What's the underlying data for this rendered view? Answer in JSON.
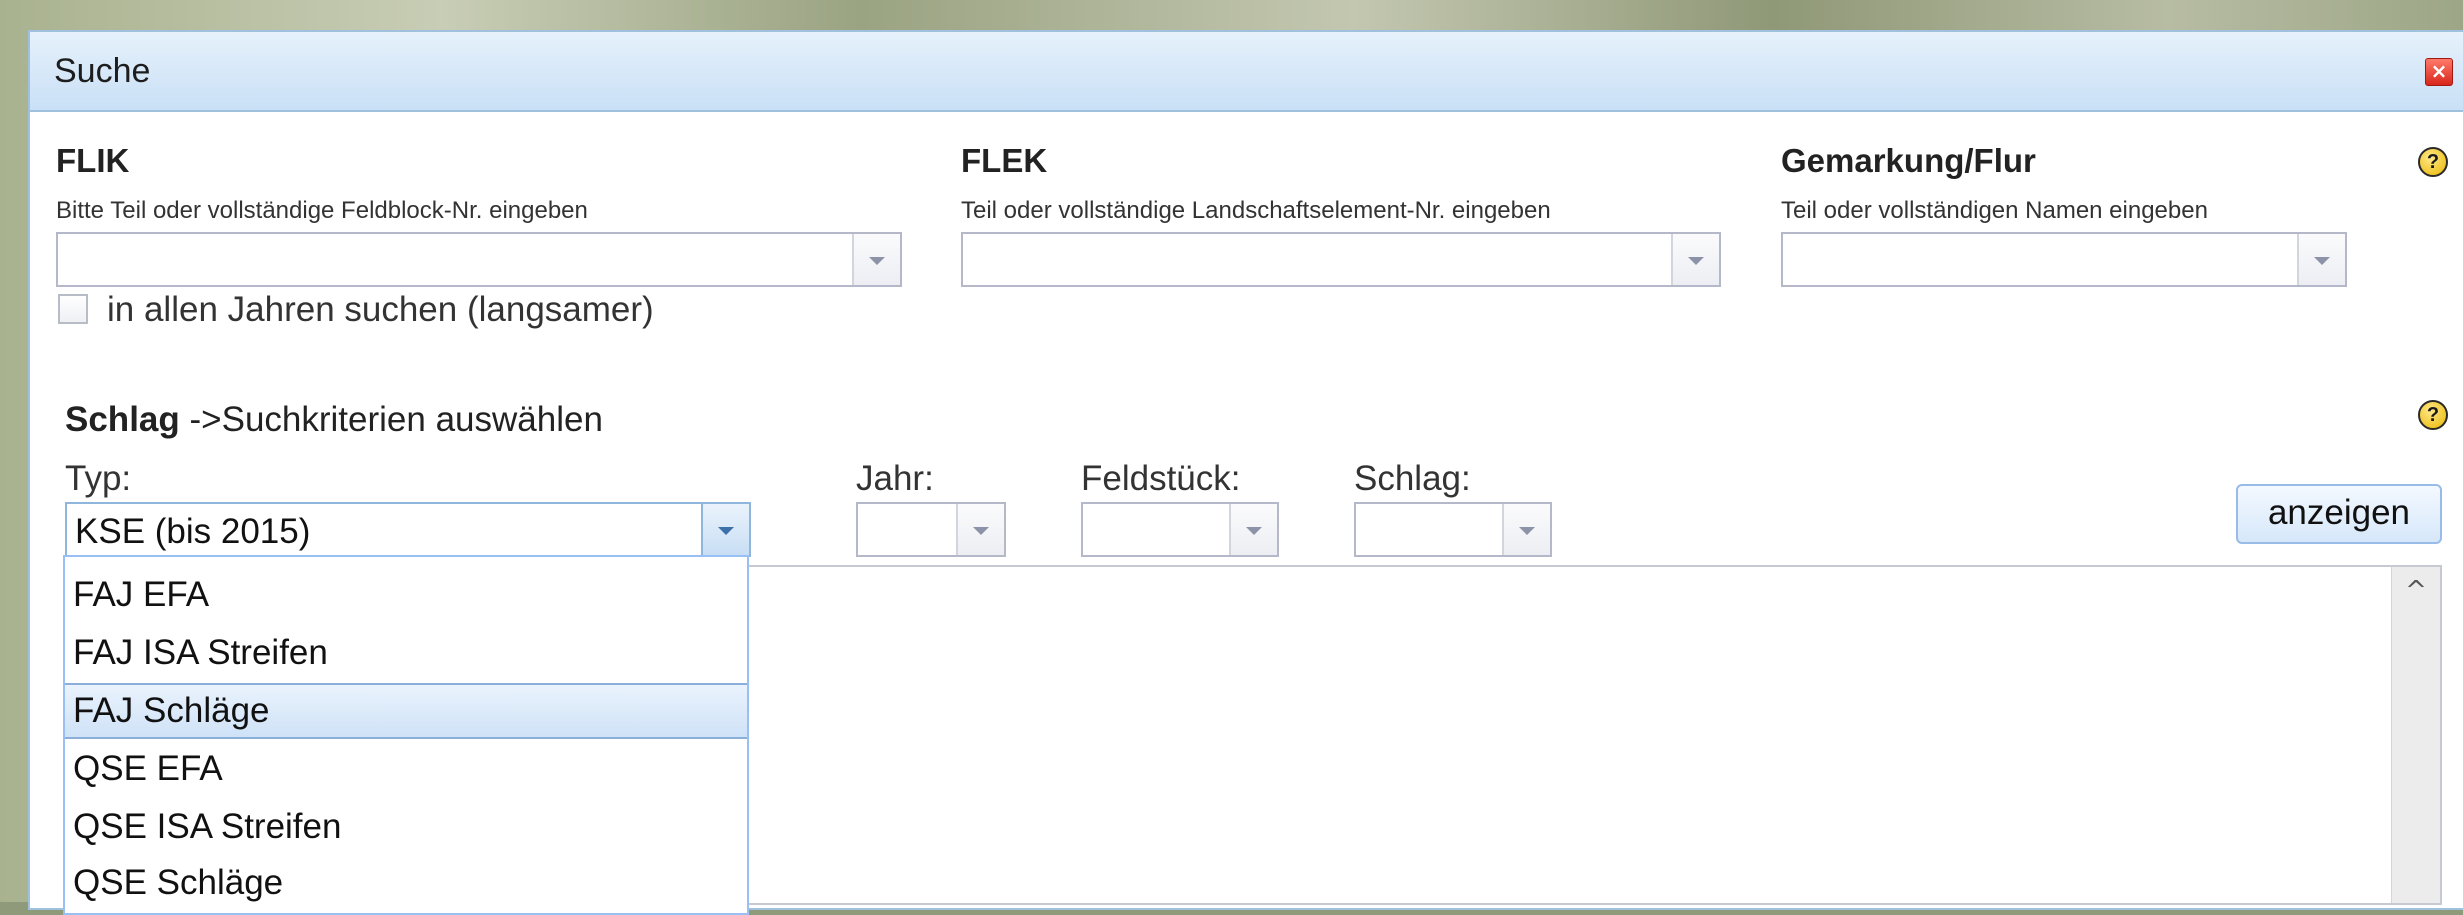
{
  "window": {
    "title": "Suche"
  },
  "flik": {
    "title": "FLIK",
    "hint": "Bitte Teil oder vollständige Feldblock-Nr. eingeben",
    "value": "",
    "all_years_label": "in allen Jahren suchen (langsamer)",
    "all_years_checked": false
  },
  "flek": {
    "title": "FLEK",
    "hint": "Teil oder vollständige Landschaftselement-Nr. eingeben",
    "value": ""
  },
  "gemarkung": {
    "title": "Gemarkung/Flur",
    "hint": "Teil oder vollständigen Namen eingeben",
    "value": ""
  },
  "schlag_section": {
    "title": "Schlag",
    "subtitle": "->Suchkriterien auswählen",
    "typ_label": "Typ:",
    "typ_value": "KSE (bis 2015)",
    "jahr_label": "Jahr:",
    "jahr_value": "",
    "feldstueck_label": "Feldstück:",
    "feldstueck_value": "",
    "schlag_label": "Schlag:",
    "schlag_value": "",
    "show_button": "anzeigen"
  },
  "typ_dropdown": {
    "options": [
      "FAJ EFA",
      "FAJ ISA Streifen",
      "FAJ Schläge",
      "QSE EFA",
      "QSE ISA Streifen",
      "QSE Schläge"
    ],
    "highlighted": "FAJ Schläge"
  },
  "icons": {
    "help": "?",
    "close": "×",
    "scroll_up": "^"
  }
}
